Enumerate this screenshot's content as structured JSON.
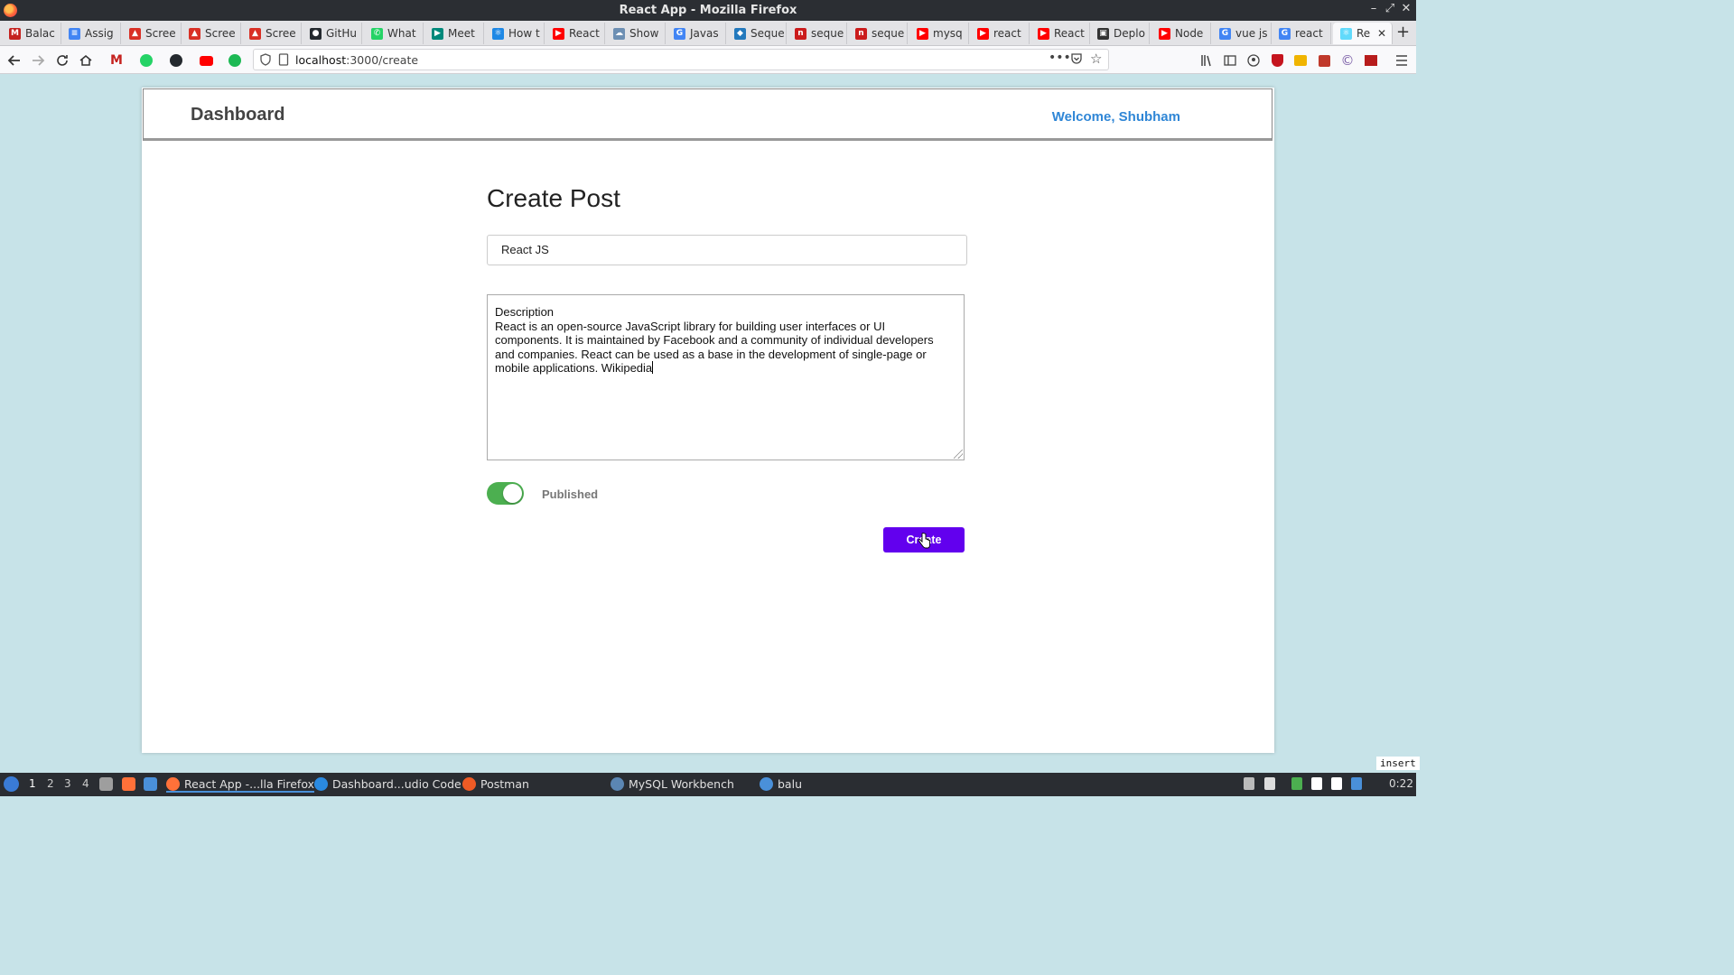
{
  "window": {
    "title": "React App - Mozilla Firefox"
  },
  "tabs": [
    {
      "label": "Balac",
      "color": "#c5221f",
      "glyph": "M"
    },
    {
      "label": "Assig",
      "color": "#4285f4",
      "glyph": "≡"
    },
    {
      "label": "Scree",
      "color": "#d93025",
      "glyph": "▲"
    },
    {
      "label": "Scree",
      "color": "#d93025",
      "glyph": "▲"
    },
    {
      "label": "Scree",
      "color": "#d93025",
      "glyph": "▲"
    },
    {
      "label": "GitHu",
      "color": "#24292e",
      "glyph": "●"
    },
    {
      "label": "What",
      "color": "#25d366",
      "glyph": "✆"
    },
    {
      "label": "Meet",
      "color": "#00897b",
      "glyph": "▶"
    },
    {
      "label": "How t",
      "color": "#1e88e5",
      "glyph": "⚛"
    },
    {
      "label": "React",
      "color": "#ff0000",
      "glyph": "▶"
    },
    {
      "label": "Show",
      "color": "#6d8fb3",
      "glyph": "☁"
    },
    {
      "label": "Javas",
      "color": "#4285f4",
      "glyph": "G"
    },
    {
      "label": "Seque",
      "color": "#2379bd",
      "glyph": "◆"
    },
    {
      "label": "seque",
      "color": "#cb1c1c",
      "glyph": "n"
    },
    {
      "label": "seque",
      "color": "#cb1c1c",
      "glyph": "n"
    },
    {
      "label": "mysq",
      "color": "#ff0000",
      "glyph": "▶"
    },
    {
      "label": "react",
      "color": "#ff0000",
      "glyph": "▶"
    },
    {
      "label": "React",
      "color": "#ff0000",
      "glyph": "▶"
    },
    {
      "label": "Deplo",
      "color": "#333333",
      "glyph": "▣"
    },
    {
      "label": "Node",
      "color": "#ff0000",
      "glyph": "▶"
    },
    {
      "label": "vue js",
      "color": "#4285f4",
      "glyph": "G"
    },
    {
      "label": "react",
      "color": "#4285f4",
      "glyph": "G"
    },
    {
      "label": "Re",
      "color": "#61dafb",
      "glyph": "⚛",
      "active": true
    }
  ],
  "navbar": {
    "url_host": "localhost",
    "url_path": ":3000/create"
  },
  "app": {
    "brand": "Dashboard",
    "welcome": "Welcome, Shubham",
    "heading": "Create Post",
    "title_value": "React JS",
    "description_value": "Description\nReact is an open-source JavaScript library for building user interfaces or UI\ncomponents. It is maintained by Facebook and a community of individual developers\nand companies. React can be used as a base in the development of single-page or\nmobile applications. Wikipedia",
    "published_label": "Published",
    "published": true,
    "create_label": "Create",
    "accent_color": "#6200ee",
    "toggle_color": "#4caf50"
  },
  "status": {
    "mode": "insert"
  },
  "taskbar": {
    "workspaces": [
      "1",
      "2",
      "3",
      "4"
    ],
    "windows": [
      {
        "label": "React App -...lla Firefox",
        "icon": "firefox-icon",
        "active": true
      },
      {
        "label": "Dashboard...udio Code",
        "icon": "vscode-icon"
      },
      {
        "label": "Postman",
        "icon": "postman-icon"
      },
      {
        "label": "MySQL Workbench",
        "icon": "mysql-workbench-icon"
      },
      {
        "label": "balu",
        "icon": "folder-icon"
      }
    ],
    "clock": "0:22"
  }
}
